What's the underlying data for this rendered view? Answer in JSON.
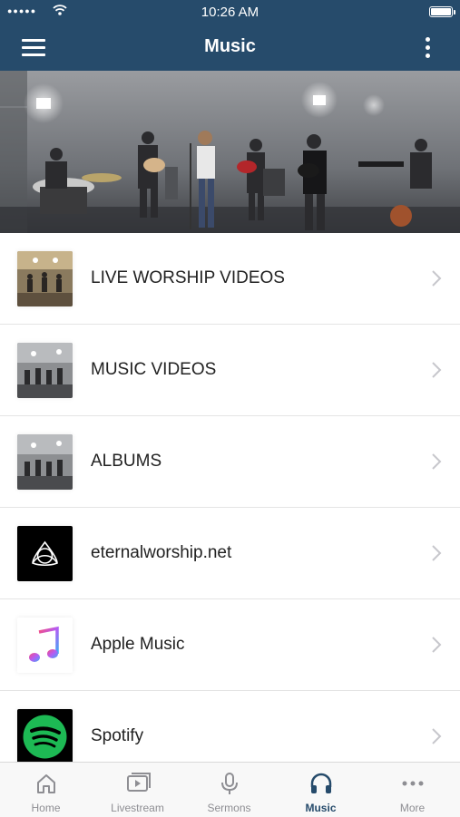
{
  "status_bar": {
    "time": "10:26 AM"
  },
  "nav": {
    "title": "Music",
    "menu_icon": "hamburger-menu-icon",
    "more_icon": "vertical-ellipsis-icon"
  },
  "list": {
    "items": [
      {
        "label": "LIVE WORSHIP VIDEOS",
        "thumb": "live-worship-thumbnail"
      },
      {
        "label": "MUSIC VIDEOS",
        "thumb": "music-videos-thumbnail"
      },
      {
        "label": "ALBUMS",
        "thumb": "albums-thumbnail"
      },
      {
        "label": "eternalworship.net",
        "thumb": "eternal-worship-logo"
      },
      {
        "label": "Apple Music",
        "thumb": "apple-music-logo"
      },
      {
        "label": "Spotify",
        "thumb": "spotify-logo"
      }
    ]
  },
  "tabbar": {
    "active": "Music",
    "tabs": [
      {
        "label": "Home",
        "icon": "home-icon"
      },
      {
        "label": "Livestream",
        "icon": "play-video-icon"
      },
      {
        "label": "Sermons",
        "icon": "microphone-icon"
      },
      {
        "label": "Music",
        "icon": "headphones-icon"
      },
      {
        "label": "More",
        "icon": "ellipsis-icon"
      }
    ]
  },
  "colors": {
    "brand": "#264b6b",
    "tab_inactive": "#8e8e93",
    "spotify": "#1db954"
  }
}
